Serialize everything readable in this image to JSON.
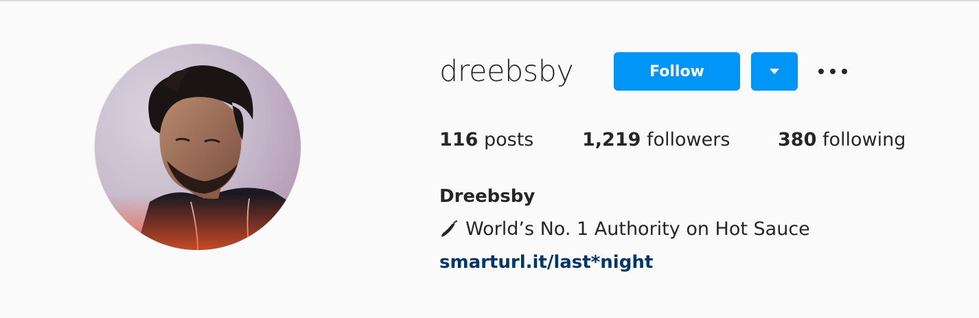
{
  "profile": {
    "username": "dreebsby",
    "follow_label": "Follow",
    "avatar_icon": "profile-photo",
    "dropdown_icon": "caret-down-icon",
    "more_icon": "more-options-icon"
  },
  "stats": {
    "posts_count": "116",
    "posts_label": "posts",
    "followers_count": "1,219",
    "followers_label": "followers",
    "following_count": "380",
    "following_label": "following"
  },
  "bio": {
    "full_name": "Dreebsby",
    "text": "World’s No. 1 Authority on Hot Sauce",
    "emoji_icon": "hot-pepper-icon",
    "link": "smarturl.it/last*night"
  },
  "colors": {
    "accent": "#0095f6",
    "link": "#00376b",
    "text": "#262626",
    "background": "#fafafa"
  }
}
